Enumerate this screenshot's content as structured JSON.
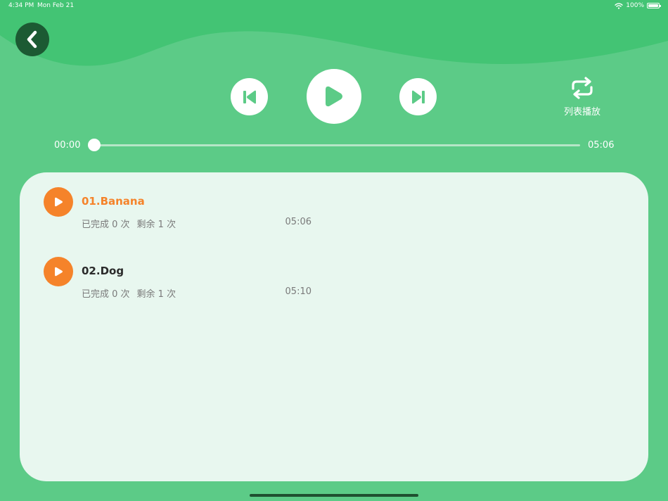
{
  "status_bar": {
    "time": "4:34 PM",
    "date": "Mon Feb 21",
    "battery": "100%"
  },
  "player": {
    "current_time": "00:00",
    "total_time": "05:06",
    "progress": 0,
    "mode_label": "列表播放"
  },
  "playlist": {
    "items": [
      {
        "title": "01.Banana",
        "completed": "已完成 0 次",
        "remaining": "剩余 1 次",
        "duration": "05:06",
        "active": true
      },
      {
        "title": "02.Dog",
        "completed": "已完成 0 次",
        "remaining": "剩余 1 次",
        "duration": "05:10",
        "active": false
      }
    ]
  },
  "colors": {
    "background": "#5ccb87",
    "wave": "#43c474",
    "panel": "#e8f7ef",
    "accent_orange": "#f5832a",
    "back_button": "#1c5a33",
    "control_icon": "#5ccb87"
  }
}
